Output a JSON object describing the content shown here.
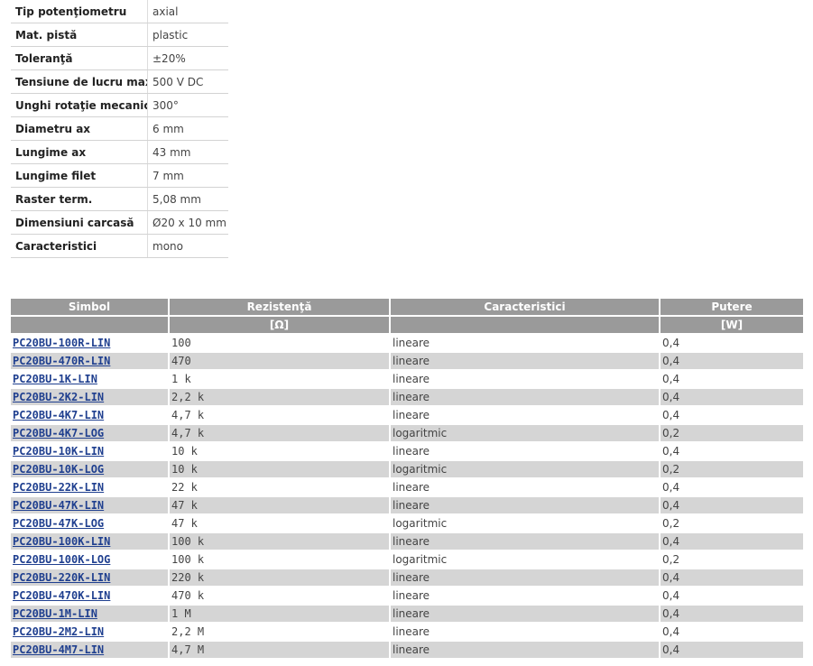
{
  "specs": [
    {
      "label": "Tip potenţiometru",
      "value": "axial"
    },
    {
      "label": "Mat. pistă",
      "value": "plastic"
    },
    {
      "label": "Toleranţă",
      "value": "±20%"
    },
    {
      "label": "Tensiune de lucru max.",
      "value": "500 V DC"
    },
    {
      "label": "Unghi rotaţie mecanică",
      "value": "300°"
    },
    {
      "label": "Diametru ax",
      "value": "6 mm"
    },
    {
      "label": "Lungime ax",
      "value": "43 mm"
    },
    {
      "label": "Lungime filet",
      "value": "7 mm"
    },
    {
      "label": "Raster term.",
      "value": "5,08 mm"
    },
    {
      "label": "Dimensiuni carcasă",
      "value": "Ø20 x 10 mm"
    },
    {
      "label": "Caracteristici",
      "value": "mono"
    }
  ],
  "products": {
    "headers": [
      "Simbol",
      "Rezistenţă",
      "Caracteristici",
      "Putere"
    ],
    "units": [
      "",
      "[Ω]",
      "",
      "[W]"
    ],
    "rows": [
      {
        "symbol": "PC20BU-100R-LIN",
        "resistance": "100",
        "characteristic": "lineare",
        "power": "0,4"
      },
      {
        "symbol": "PC20BU-470R-LIN",
        "resistance": "470",
        "characteristic": "lineare",
        "power": "0,4"
      },
      {
        "symbol": "PC20BU-1K-LIN",
        "resistance": "1 k",
        "characteristic": "lineare",
        "power": "0,4"
      },
      {
        "symbol": "PC20BU-2K2-LIN",
        "resistance": "2,2 k",
        "characteristic": "lineare",
        "power": "0,4"
      },
      {
        "symbol": "PC20BU-4K7-LIN",
        "resistance": "4,7 k",
        "characteristic": "lineare",
        "power": "0,4"
      },
      {
        "symbol": "PC20BU-4K7-LOG",
        "resistance": "4,7 k",
        "characteristic": "logaritmic",
        "power": "0,2"
      },
      {
        "symbol": "PC20BU-10K-LIN",
        "resistance": "10 k",
        "characteristic": "lineare",
        "power": "0,4"
      },
      {
        "symbol": "PC20BU-10K-LOG",
        "resistance": "10 k",
        "characteristic": "logaritmic",
        "power": "0,2"
      },
      {
        "symbol": "PC20BU-22K-LIN",
        "resistance": "22 k",
        "characteristic": "lineare",
        "power": "0,4"
      },
      {
        "symbol": "PC20BU-47K-LIN",
        "resistance": "47 k",
        "characteristic": "lineare",
        "power": "0,4"
      },
      {
        "symbol": "PC20BU-47K-LOG",
        "resistance": "47 k",
        "characteristic": "logaritmic",
        "power": "0,2"
      },
      {
        "symbol": "PC20BU-100K-LIN",
        "resistance": "100 k",
        "characteristic": "lineare",
        "power": "0,4"
      },
      {
        "symbol": "PC20BU-100K-LOG",
        "resistance": "100 k",
        "characteristic": "logaritmic",
        "power": "0,2"
      },
      {
        "symbol": "PC20BU-220K-LIN",
        "resistance": "220 k",
        "characteristic": "lineare",
        "power": "0,4"
      },
      {
        "symbol": "PC20BU-470K-LIN",
        "resistance": "470 k",
        "characteristic": "lineare",
        "power": "0,4"
      },
      {
        "symbol": "PC20BU-1M-LIN",
        "resistance": "1 M",
        "characteristic": "lineare",
        "power": "0,4"
      },
      {
        "symbol": "PC20BU-2M2-LIN",
        "resistance": "2,2 M",
        "characteristic": "lineare",
        "power": "0,4"
      },
      {
        "symbol": "PC20BU-4M7-LIN",
        "resistance": "4,7 M",
        "characteristic": "lineare",
        "power": "0,4"
      }
    ]
  },
  "colors": {
    "header_bg": "#9a9a9a",
    "row_alt_bg": "#d5d5d5",
    "link": "#1f3f8f"
  }
}
